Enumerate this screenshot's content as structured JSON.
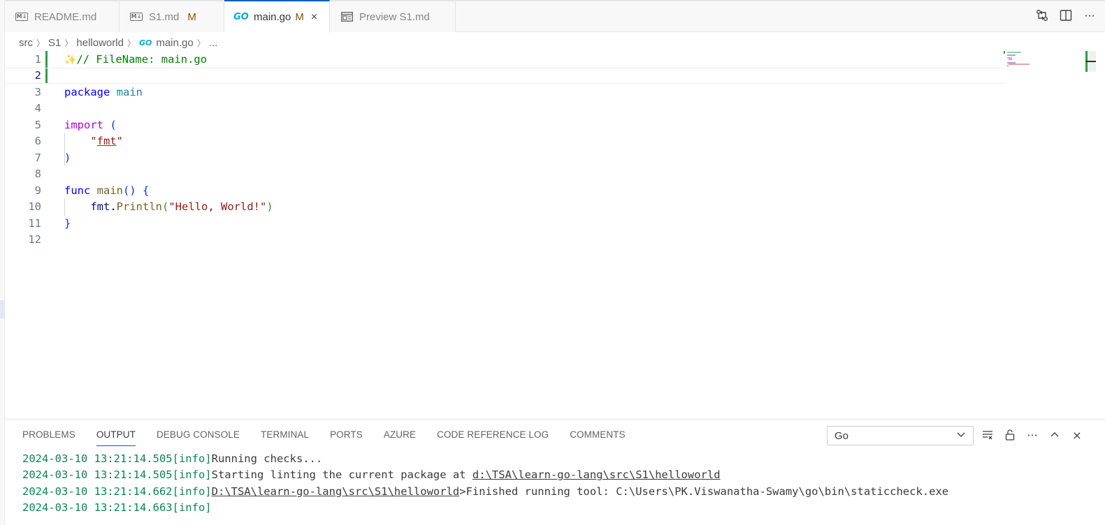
{
  "tabs": [
    {
      "label": "README.md",
      "icon": "markdown-icon",
      "modified": ""
    },
    {
      "label": "S1.md",
      "icon": "markdown-icon",
      "modified": "M"
    },
    {
      "label": "main.go",
      "icon": "go-icon",
      "modified": "M",
      "active": true
    },
    {
      "label": "Preview S1.md",
      "icon": "preview-icon",
      "modified": ""
    }
  ],
  "icons": {
    "markdown": "M↓",
    "go": "GO",
    "close": "×",
    "compare": "⇄",
    "split": "◫",
    "more": "···",
    "chevron_up": "^",
    "close_panel": "×"
  },
  "breadcrumb": {
    "items": [
      "src",
      "S1",
      "helloworld",
      "main.go",
      "..."
    ]
  },
  "editor": {
    "line_numbers": [
      "1",
      "2",
      "3",
      "4",
      "5",
      "6",
      "7",
      "8",
      "9",
      "10",
      "11",
      "12"
    ],
    "line1": {
      "sparkle": "✨",
      "comment": "// FileName: main.go"
    },
    "line3": {
      "kw": "package",
      "name": "main"
    },
    "line5": {
      "kw": "import",
      "paren": "("
    },
    "line6": {
      "q1": "\"",
      "pkg": "fmt",
      "q2": "\""
    },
    "line7": {
      "paren": ")"
    },
    "line9": {
      "kw": "func",
      "name": "main",
      "parens": "()",
      "brace": "{"
    },
    "line10": {
      "obj": "fmt",
      "dot": ".",
      "fn": "Println",
      "p1": "(",
      "str": "\"Hello, World!\"",
      "p2": ")"
    },
    "line11": {
      "brace": "}"
    }
  },
  "panel": {
    "tabs": [
      "PROBLEMS",
      "OUTPUT",
      "DEBUG CONSOLE",
      "TERMINAL",
      "PORTS",
      "AZURE",
      "CODE REFERENCE LOG",
      "COMMENTS"
    ],
    "active_tab": "OUTPUT",
    "output_channel": "Go",
    "output": [
      {
        "ts": "2024-03-10 13:21:14.505",
        "level": "[info]",
        "msg": "Running checks...",
        "link": "",
        "tail": ""
      },
      {
        "ts": "2024-03-10 13:21:14.505",
        "level": "[info]",
        "msg": "Starting linting the current package at ",
        "link": "d:\\TSA\\learn-go-lang\\src\\S1\\helloworld",
        "tail": ""
      },
      {
        "ts": "2024-03-10 13:21:14.662",
        "level": "[info]",
        "msg": "",
        "link": "D:\\TSA\\learn-go-lang\\src\\S1\\helloworld",
        "tail": ">Finished running tool: C:\\Users\\PK.Viswanatha-Swamy\\go\\bin\\staticcheck.exe"
      },
      {
        "ts": "2024-03-10 13:21:14.663",
        "level": "[info]",
        "msg": "",
        "link": "",
        "tail": ""
      }
    ]
  },
  "colors": {
    "accent": "#005fb8",
    "modified": "#895503",
    "git_added": "#2ea043"
  }
}
